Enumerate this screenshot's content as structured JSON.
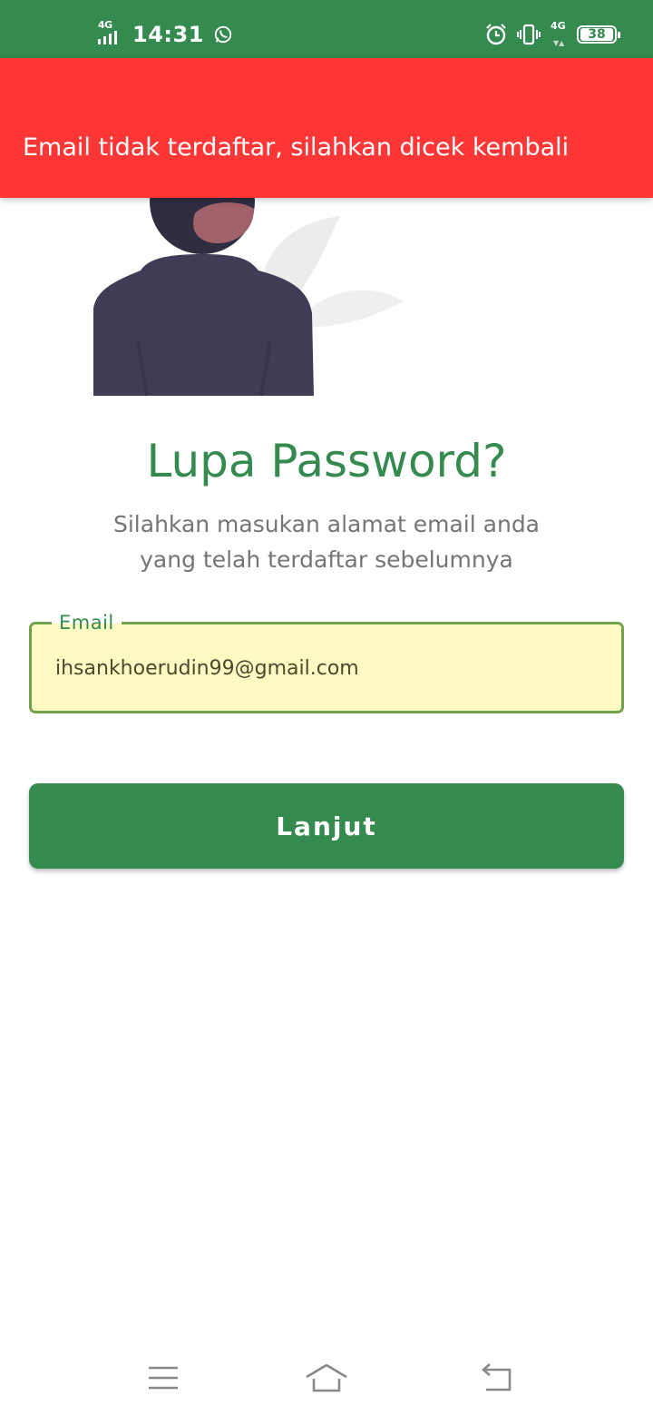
{
  "status_bar": {
    "network_left": "4G",
    "time": "14:31",
    "network_right": "4G",
    "battery": "38",
    "icons": [
      "signal-icon",
      "whatsapp-icon",
      "alarm-icon",
      "vibrate-icon",
      "battery-icon"
    ]
  },
  "snackbar": {
    "message": "Email tidak terdaftar, silahkan dicek kembali",
    "color": "#FF3636"
  },
  "page": {
    "title": "Lupa Password?",
    "subtitle_line1": "Silahkan masukan alamat email anda",
    "subtitle_line2": "yang telah terdaftar sebelumnya",
    "accent_color": "#358A4F"
  },
  "email_field": {
    "label": "Email",
    "value": "ihsankhoerudin99@gmail.com",
    "fill_color": "#FFF9C4"
  },
  "submit_button": {
    "label": "Lanjut"
  },
  "nav_bar": {
    "icons": [
      "menu-icon",
      "home-icon",
      "back-icon"
    ]
  }
}
